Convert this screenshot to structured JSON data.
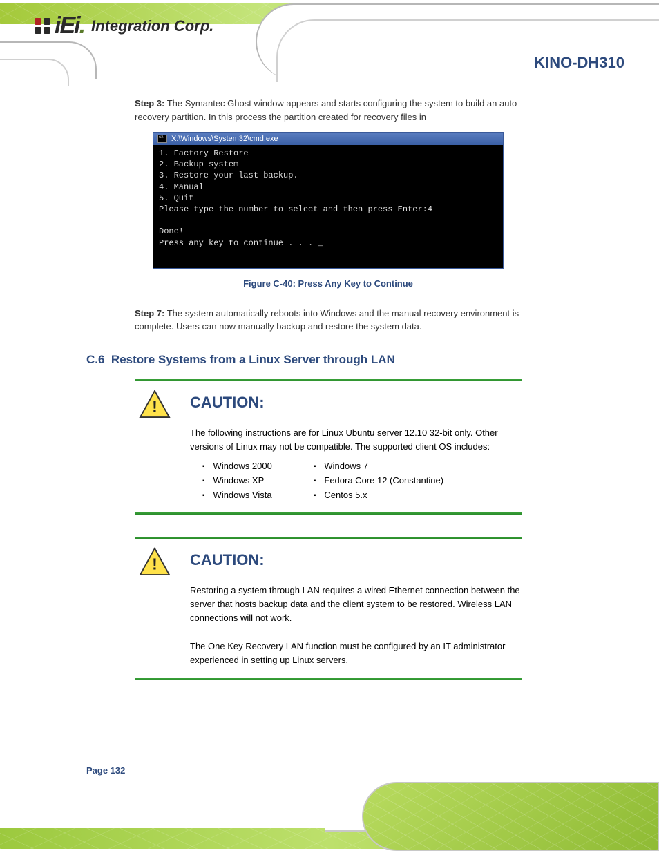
{
  "brand": {
    "name_iei": "iEi",
    "name_corp": "Integration Corp."
  },
  "header": {
    "product": "KINO-DH310"
  },
  "step3": {
    "label": "Step 3:",
    "text": "The Symantec Ghost window appears and starts configuring the system to build an auto recovery partition. In this process the partition created for recovery files in"
  },
  "cmd": {
    "title": "X:\\Windows\\System32\\cmd.exe",
    "body": "1. Factory Restore\n2. Backup system\n3. Restore your last backup.\n4. Manual\n5. Quit\nPlease type the number to select and then press Enter:4\n\nDone!\nPress any key to continue . . . _"
  },
  "figure": {
    "caption": "Figure C-40: Press Any Key to Continue"
  },
  "step7": {
    "label": "Step 7:",
    "text": "The system automatically reboots into Windows and the manual recovery environment is complete. Users can now manually backup and restore the system data."
  },
  "section": {
    "num": "C.6",
    "title": "Restore Systems from a Linux Server through LAN"
  },
  "caution1": {
    "title": "CAUTION:",
    "body": "The following instructions are for Linux Ubuntu server 12.10 32-bit only. Other versions of Linux may not be compatible. The supported client OS includes:",
    "col1": [
      "Windows 2000",
      "Windows XP",
      "Windows Vista"
    ],
    "col2": [
      "Windows 7",
      "Fedora Core 12 (Constantine)",
      "Centos 5.x"
    ]
  },
  "caution2": {
    "title": "CAUTION:",
    "body": "Restoring a system through LAN requires a wired Ethernet connection between the server that hosts backup data and the client system to be restored. Wireless LAN connections will not work.\n\nThe One Key Recovery LAN function must be configured by an IT administrator experienced in setting up Linux servers."
  },
  "footer": {
    "page": "Page 132"
  }
}
